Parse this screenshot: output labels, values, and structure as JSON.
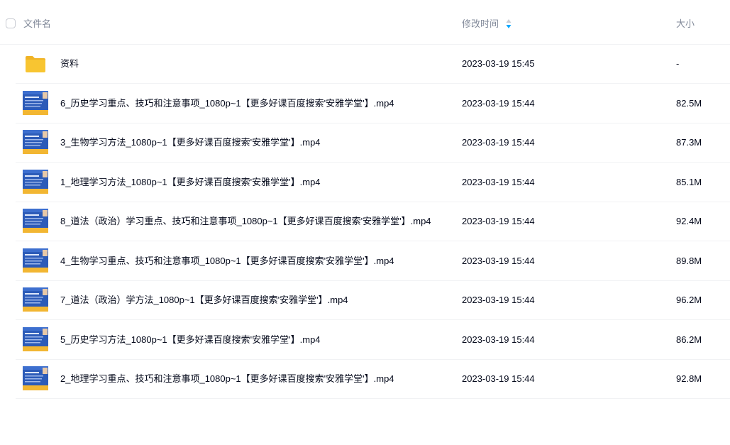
{
  "header": {
    "name_label": "文件名",
    "time_label": "修改时间",
    "size_label": "大小",
    "sort_icon": "sort-arrows-icon"
  },
  "colors": {
    "accent": "#06a7ff",
    "folder": "#f8c531",
    "thumb_blue": "#2c5bb8",
    "thumb_yellow": "#f2b632"
  },
  "files": [
    {
      "type": "folder",
      "icon": "folder-icon",
      "name": "资料",
      "time": "2023-03-19 15:45",
      "size": "-"
    },
    {
      "type": "video",
      "icon": "video-thumbnail-icon",
      "name": "6_历史学习重点、技巧和注意事项_1080p~1【更多好课百度搜索'安雅学堂'】.mp4",
      "time": "2023-03-19 15:44",
      "size": "82.5M"
    },
    {
      "type": "video",
      "icon": "video-thumbnail-icon",
      "name": "3_生物学习方法_1080p~1【更多好课百度搜索'安雅学堂'】.mp4",
      "time": "2023-03-19 15:44",
      "size": "87.3M"
    },
    {
      "type": "video",
      "icon": "video-thumbnail-icon",
      "name": "1_地理学习方法_1080p~1【更多好课百度搜索'安雅学堂'】.mp4",
      "time": "2023-03-19 15:44",
      "size": "85.1M"
    },
    {
      "type": "video",
      "icon": "video-thumbnail-icon",
      "name": "8_道法（政治）学习重点、技巧和注意事项_1080p~1【更多好课百度搜索'安雅学堂'】.mp4",
      "time": "2023-03-19 15:44",
      "size": "92.4M"
    },
    {
      "type": "video",
      "icon": "video-thumbnail-icon",
      "name": "4_生物学习重点、技巧和注意事项_1080p~1【更多好课百度搜索'安雅学堂'】.mp4",
      "time": "2023-03-19 15:44",
      "size": "89.8M"
    },
    {
      "type": "video",
      "icon": "video-thumbnail-icon",
      "name": "7_道法（政治）学方法_1080p~1【更多好课百度搜索'安雅学堂'】.mp4",
      "time": "2023-03-19 15:44",
      "size": "96.2M"
    },
    {
      "type": "video",
      "icon": "video-thumbnail-icon",
      "name": "5_历史学习方法_1080p~1【更多好课百度搜索'安雅学堂'】.mp4",
      "time": "2023-03-19 15:44",
      "size": "86.2M"
    },
    {
      "type": "video",
      "icon": "video-thumbnail-icon",
      "name": "2_地理学习重点、技巧和注意事项_1080p~1【更多好课百度搜索'安雅学堂'】.mp4",
      "time": "2023-03-19 15:44",
      "size": "92.8M"
    }
  ]
}
